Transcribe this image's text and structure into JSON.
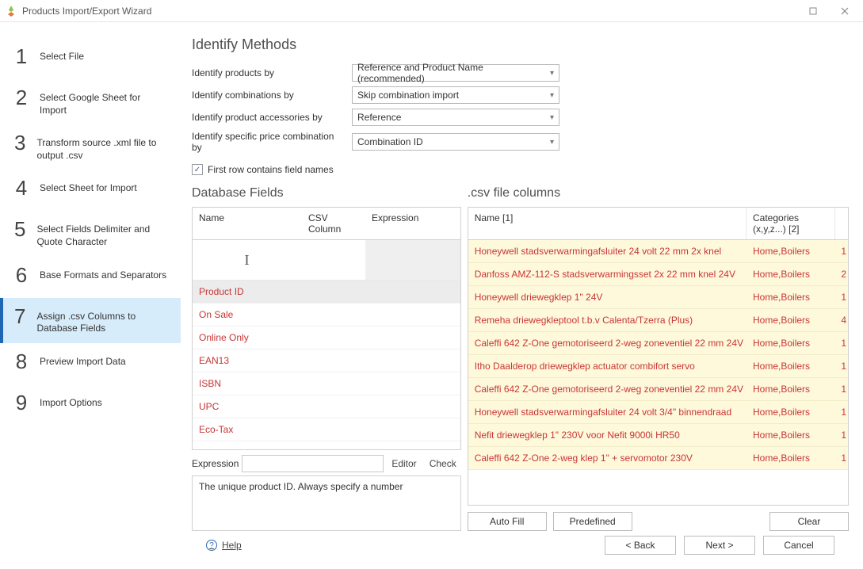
{
  "window": {
    "title": "Products Import/Export Wizard"
  },
  "steps": [
    {
      "num": "1",
      "label": "Select File"
    },
    {
      "num": "2",
      "label": "Select Google Sheet for Import"
    },
    {
      "num": "3",
      "label": "Transform source .xml file to output .csv"
    },
    {
      "num": "4",
      "label": "Select Sheet for Import"
    },
    {
      "num": "5",
      "label": "Select Fields Delimiter and Quote Character"
    },
    {
      "num": "6",
      "label": "Base Formats and Separators"
    },
    {
      "num": "7",
      "label": "Assign .csv Columns to Database Fields"
    },
    {
      "num": "8",
      "label": "Preview Import Data"
    },
    {
      "num": "9",
      "label": "Import Options"
    }
  ],
  "identify": {
    "title": "Identify Methods",
    "rows": [
      {
        "label": "Identify products by",
        "value": "Reference and Product Name (recommended)"
      },
      {
        "label": "Identify combinations by",
        "value": "Skip combination import"
      },
      {
        "label": "Identify product accessories by",
        "value": "Reference"
      },
      {
        "label": "Identify specific price combination by",
        "value": "Combination ID"
      }
    ],
    "firstRowHeader": "First row contains field names"
  },
  "dbFields": {
    "title": "Database Fields",
    "headers": {
      "name": "Name",
      "csv": "CSV Column",
      "exp": "Expression"
    },
    "rows": [
      "Product ID",
      "On Sale",
      "Online Only",
      "EAN13",
      "ISBN",
      "UPC",
      "Eco-Tax"
    ],
    "exprLabel": "Expression",
    "editor": "Editor",
    "check": "Check",
    "desc": "The unique product ID. Always specify a number"
  },
  "csvCols": {
    "title": ".csv file columns",
    "headers": {
      "name": "Name [1]",
      "cat": "Categories (x,y,z...) [2]"
    },
    "rows": [
      {
        "name": "Honeywell stadsverwarmingafsluiter 24 volt 22 mm 2x knel",
        "cat": "Home,Boilers",
        "n": "1"
      },
      {
        "name": "Danfoss AMZ-112-S stadsverwarmingsset 2x 22 mm knel 24V",
        "cat": "Home,Boilers",
        "n": "2"
      },
      {
        "name": "Honeywell driewegklep 1\" 24V",
        "cat": "Home,Boilers",
        "n": "1"
      },
      {
        "name": "Remeha driewegkleptool t.b.v Calenta/Tzerra (Plus)",
        "cat": "Home,Boilers",
        "n": "4"
      },
      {
        "name": "Caleffi 642 Z-One gemotoriseerd 2-weg zoneventiel 22 mm 24V",
        "cat": "Home,Boilers",
        "n": "1"
      },
      {
        "name": "Itho Daalderop driewegklep actuator combifort servo",
        "cat": "Home,Boilers",
        "n": "1"
      },
      {
        "name": "Caleffi 642 Z-One gemotoriseerd 2-weg zoneventiel 22 mm 24V",
        "cat": "Home,Boilers",
        "n": "1"
      },
      {
        "name": "Honeywell stadsverwarmingafsluiter 24 volt 3/4\" binnendraad",
        "cat": "Home,Boilers",
        "n": "1"
      },
      {
        "name": "Nefit driewegklep 1\" 230V voor Nefit 9000i HR50",
        "cat": "Home,Boilers",
        "n": "1"
      },
      {
        "name": "Caleffi 642 Z-One 2-weg klep 1\" + servomotor 230V",
        "cat": "Home,Boilers",
        "n": "1"
      }
    ],
    "autofill": "Auto Fill",
    "predefined": "Predefined",
    "clear": "Clear"
  },
  "footer": {
    "help": "Help",
    "back": "< Back",
    "next": "Next >",
    "cancel": "Cancel"
  }
}
